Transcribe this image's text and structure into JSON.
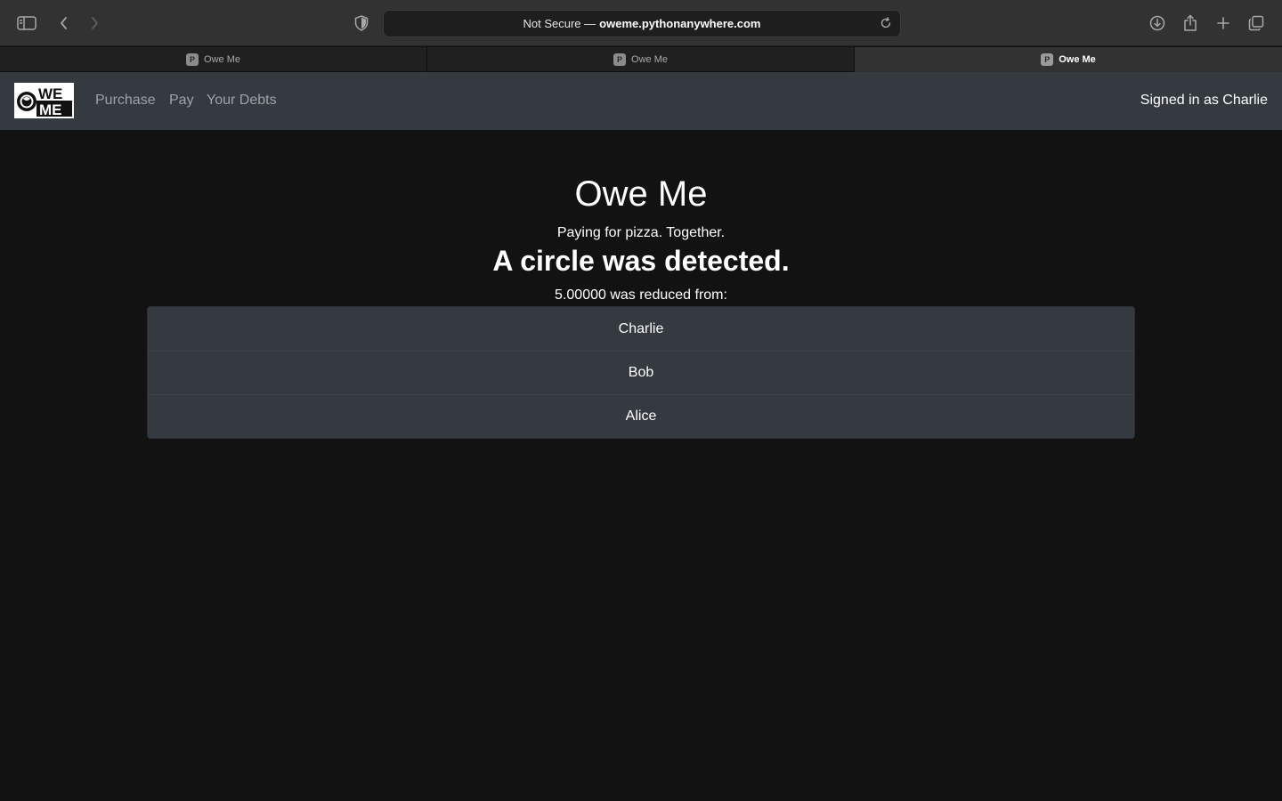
{
  "browser": {
    "address": {
      "prefix": "Not Secure —",
      "host": "oweme.pythonanywhere.com"
    },
    "tabs": [
      {
        "label": "Owe Me",
        "favicon": "P",
        "active": false
      },
      {
        "label": "Owe Me",
        "favicon": "P",
        "active": false
      },
      {
        "label": "Owe Me",
        "favicon": "P",
        "active": true
      }
    ],
    "icons": {
      "sidebar": "sidebar-icon",
      "back": "chevron-left-icon",
      "forward": "chevron-right-icon",
      "privacy": "shield-icon",
      "reload": "reload-icon",
      "downloads": "download-icon",
      "share": "share-icon",
      "new_tab": "plus-icon",
      "tab_overview": "tabs-overview-icon"
    }
  },
  "navbar": {
    "logo_text": [
      "WE",
      "ME"
    ],
    "links": [
      "Purchase",
      "Pay",
      "Your Debts"
    ],
    "signed_in": "Signed in as Charlie"
  },
  "main": {
    "title": "Owe Me",
    "tagline": "Paying for pizza. Together.",
    "headline": "A circle was detected.",
    "reduced_text": "5.00000 was reduced from:",
    "people": [
      "Charlie",
      "Bob",
      "Alice"
    ]
  },
  "colors": {
    "page_bg": "#121212",
    "navbar_bg": "#343a40",
    "list_bg": "#343a40",
    "nav_link": "#9da2a6"
  }
}
